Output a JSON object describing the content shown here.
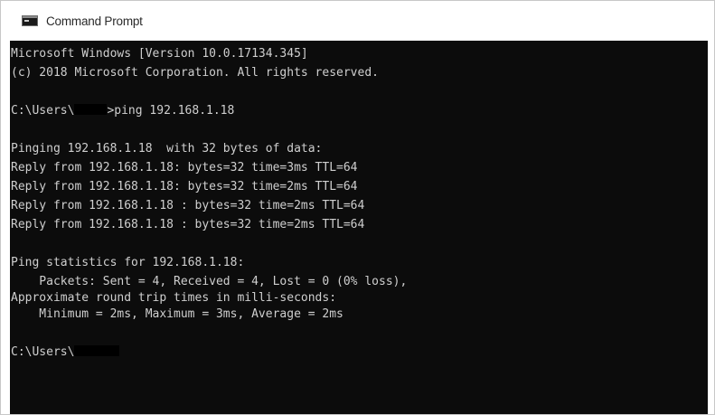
{
  "window": {
    "title": "Command Prompt",
    "icon": "cmd-icon"
  },
  "console": {
    "lines": [
      "Microsoft Windows [Version 10.0.17134.345]",
      "(c) 2018 Microsoft Corporation. All rights reserved.",
      "",
      "C:\\Users\\",
      ">ping 192.168.1.18",
      "",
      "Pinging 192.168.1.18  with 32 bytes of data:",
      "Reply from 192.168.1.18: bytes=32 time=3ms TTL=64",
      "Reply from 192.168.1.18: bytes=32 time=2ms TTL=64",
      "Reply from 192.168.1.18 : bytes=32 time=2ms TTL=64",
      "Reply from 192.168.1.18 : bytes=32 time=2ms TTL=64",
      "",
      "Ping statistics for 192.168.1.18:",
      "    Packets: Sent = 4, Received = 4, Lost = 0 (0% loss),",
      "Approximate round trip times in milli-seconds:",
      "    Minimum = 2ms, Maximum = 3ms, Average = 2ms",
      "",
      "C:\\Users\\"
    ]
  },
  "colors": {
    "console_bg": "#0c0c0c",
    "console_text": "#cfcfcf",
    "titlebar_bg": "#ffffff"
  }
}
